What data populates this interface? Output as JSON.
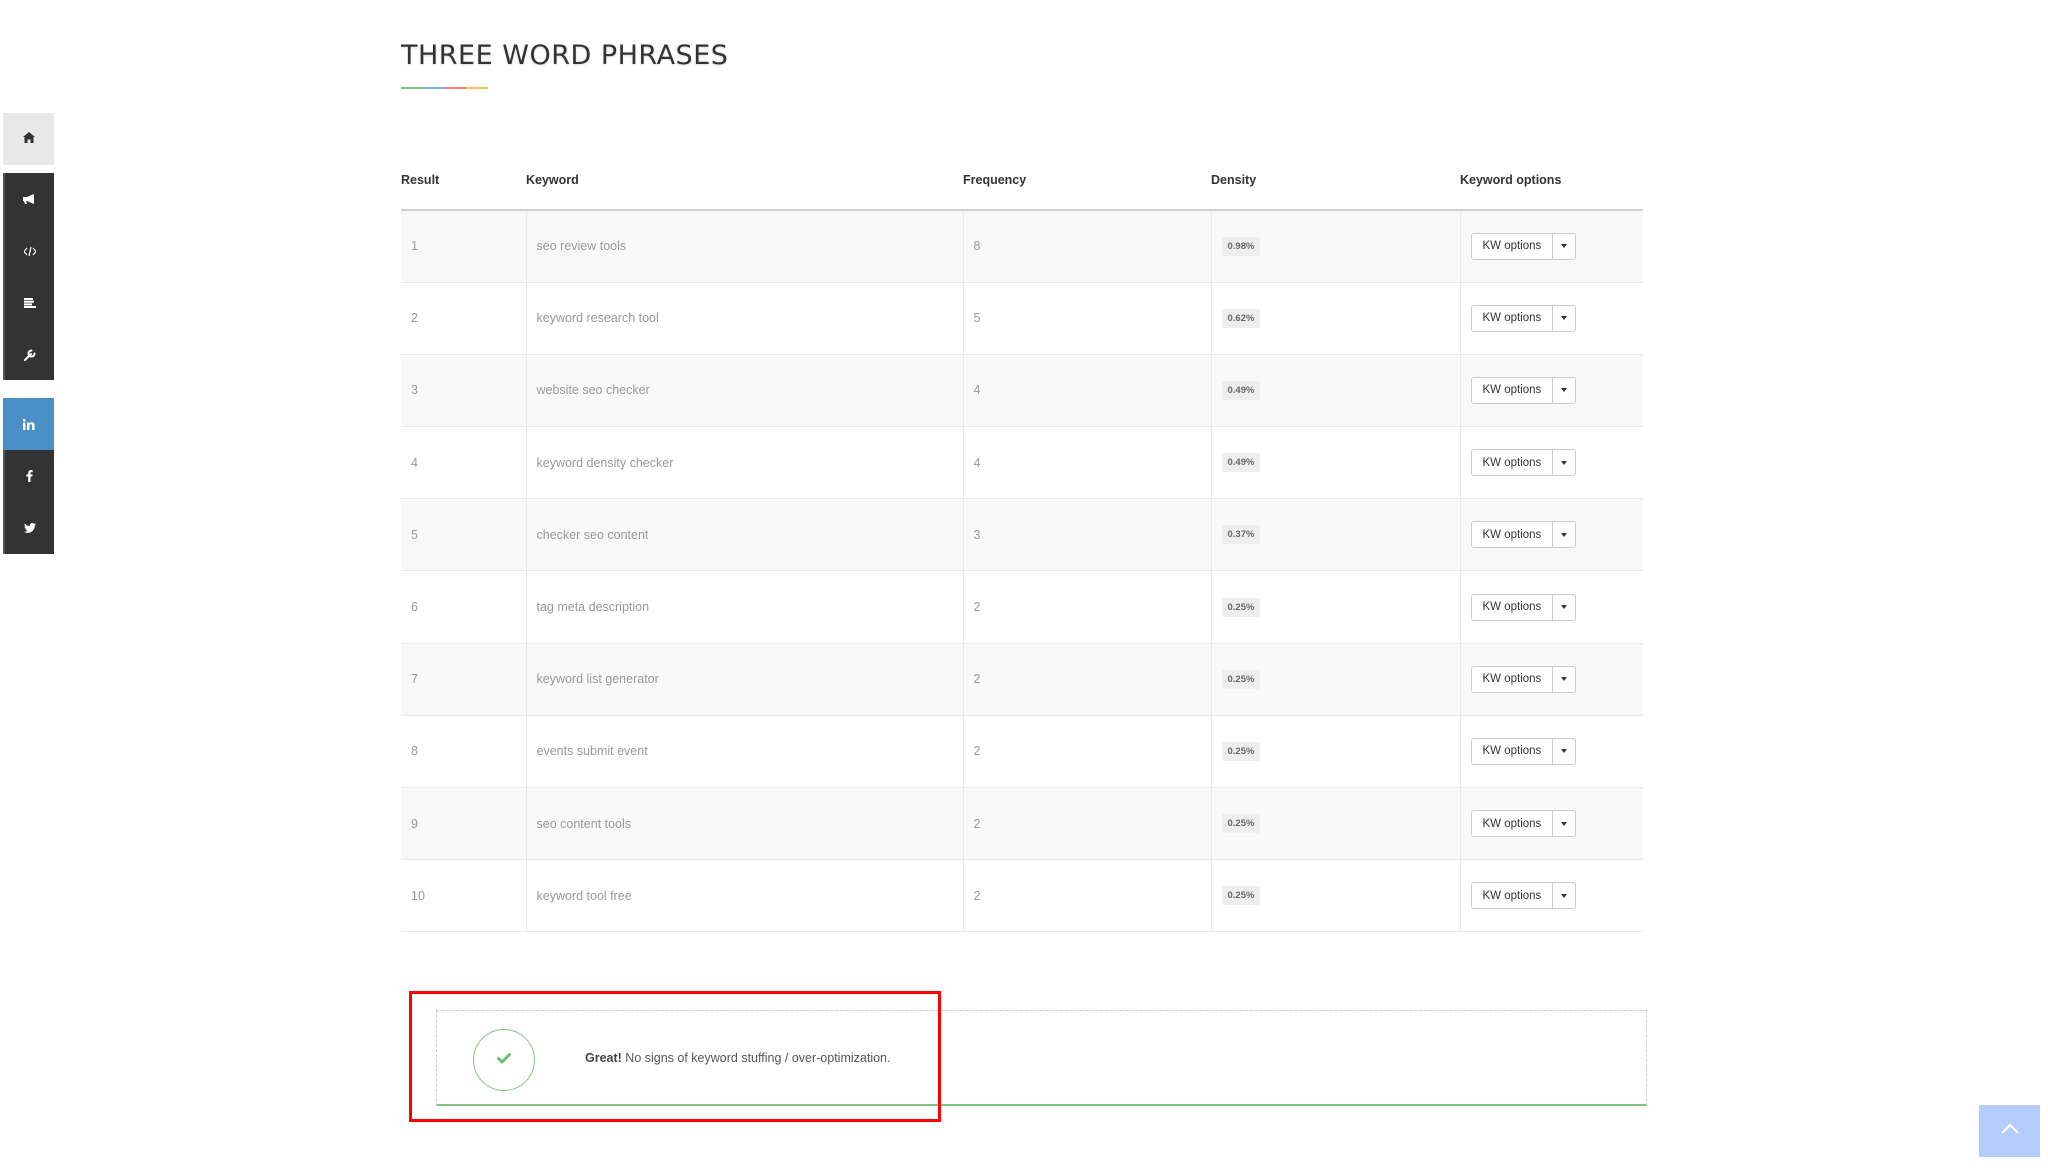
{
  "section": {
    "title": "THREE WORD PHRASES",
    "underline_colors": [
      "#7cc47f",
      "#7fb3e0",
      "#f27b7b",
      "#f4c26b"
    ]
  },
  "sidebar": {
    "home": {
      "icon": "home-icon"
    },
    "tools": [
      {
        "icon": "megaphone-icon",
        "label": "Announcements"
      },
      {
        "icon": "code-icon",
        "label": "Code"
      },
      {
        "icon": "align-left-icon",
        "label": "Content"
      },
      {
        "icon": "wrench-icon",
        "label": "Tools"
      }
    ],
    "social": [
      {
        "icon": "linkedin-icon",
        "label": "in",
        "color": "#4a8fc5"
      },
      {
        "icon": "facebook-icon",
        "label": "f"
      },
      {
        "icon": "twitter-icon",
        "label": "twitter"
      }
    ]
  },
  "table": {
    "headers": {
      "result": "Result",
      "keyword": "Keyword",
      "frequency": "Frequency",
      "density": "Density",
      "options": "Keyword options"
    },
    "button_label": "KW options",
    "rows": [
      {
        "result": "1",
        "keyword": "seo review tools",
        "frequency": "8",
        "density": "0.98%"
      },
      {
        "result": "2",
        "keyword": "keyword research tool",
        "frequency": "5",
        "density": "0.62%"
      },
      {
        "result": "3",
        "keyword": "website seo checker",
        "frequency": "4",
        "density": "0.49%"
      },
      {
        "result": "4",
        "keyword": "keyword density checker",
        "frequency": "4",
        "density": "0.49%"
      },
      {
        "result": "5",
        "keyword": "checker seo content",
        "frequency": "3",
        "density": "0.37%"
      },
      {
        "result": "6",
        "keyword": "tag meta description",
        "frequency": "2",
        "density": "0.25%"
      },
      {
        "result": "7",
        "keyword": "keyword list generator",
        "frequency": "2",
        "density": "0.25%"
      },
      {
        "result": "8",
        "keyword": "events submit event",
        "frequency": "2",
        "density": "0.25%"
      },
      {
        "result": "9",
        "keyword": "seo content tools",
        "frequency": "2",
        "density": "0.25%"
      },
      {
        "result": "10",
        "keyword": "keyword tool free",
        "frequency": "2",
        "density": "0.25%"
      }
    ]
  },
  "alert": {
    "strong": "Great!",
    "message": " No signs of keyword stuffing / over-optimization.",
    "status": "success",
    "color": "#7cc47f"
  },
  "back_to_top": {
    "icon": "chevron-up-icon"
  }
}
